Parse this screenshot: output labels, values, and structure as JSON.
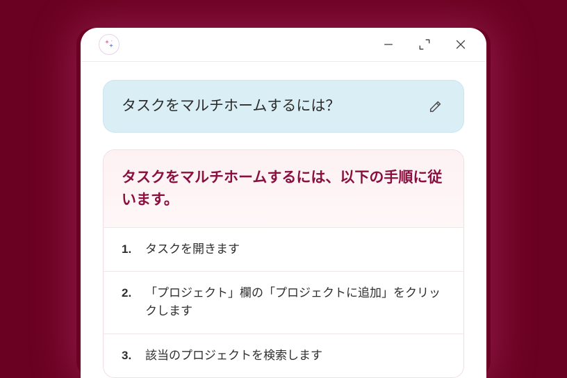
{
  "colors": {
    "background": "#6a0022",
    "accent": "#8a0f3e",
    "query_bg": "#d9eef5"
  },
  "appIcon": "sparkle",
  "window": {
    "minimize": "minimize",
    "expand": "expand",
    "close": "close"
  },
  "query": {
    "text": "タスクをマルチホームするには？",
    "editIcon": "pencil"
  },
  "answer": {
    "heading": "タスクをマルチホームするには、以下の手順に従います。",
    "steps": [
      {
        "num": "1.",
        "text": "タスクを開きます"
      },
      {
        "num": "2.",
        "text": "「プロジェクト」欄の「プロジェクトに追加」をクリックします"
      },
      {
        "num": "3.",
        "text": "該当のプロジェクトを検索します"
      }
    ]
  }
}
